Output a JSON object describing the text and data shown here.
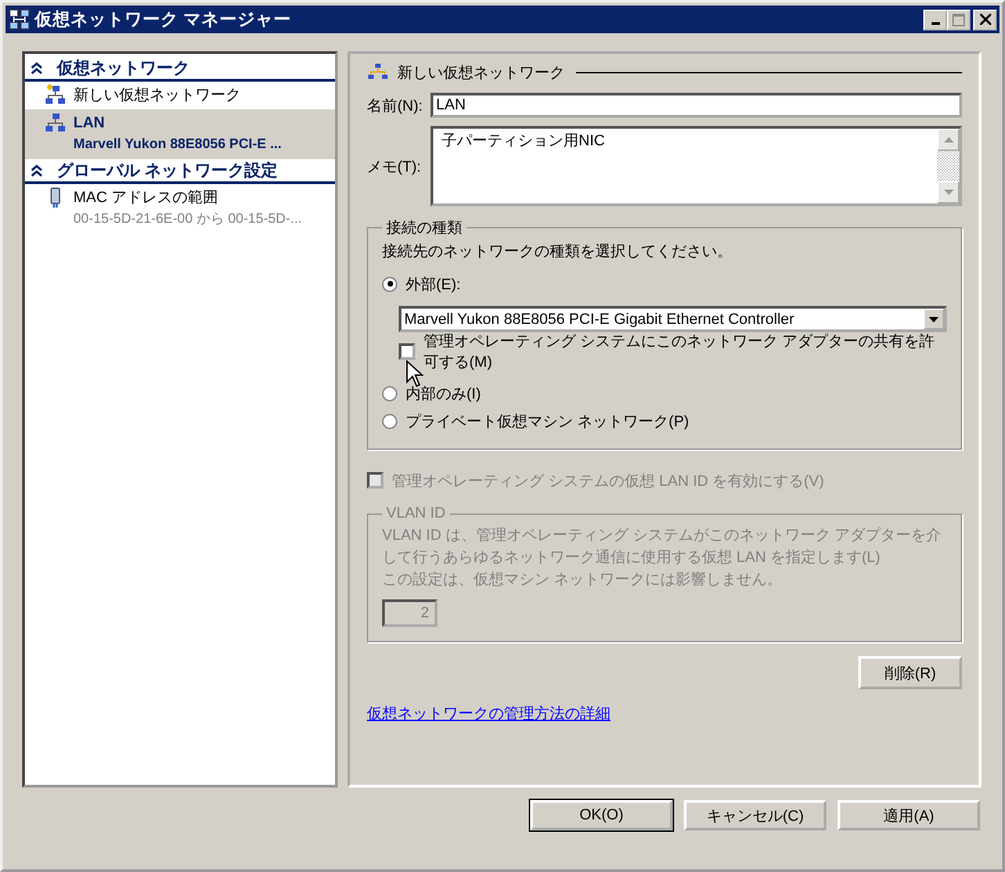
{
  "window": {
    "title": "仮想ネットワーク マネージャー"
  },
  "sidebar": {
    "sections": [
      {
        "title": "仮想ネットワーク",
        "expanded": true,
        "items": [
          {
            "kind": "new",
            "label": "新しい仮想ネットワーク",
            "selected": false
          },
          {
            "kind": "network",
            "label": "LAN",
            "detail": "Marvell Yukon 88E8056 PCI-E ...",
            "selected": true
          }
        ]
      },
      {
        "title": "グローバル ネットワーク設定",
        "expanded": true,
        "items": [
          {
            "kind": "mac",
            "label": "MAC アドレスの範囲",
            "detail": "00-15-5D-21-6E-00 から 00-15-5D-...",
            "selected": false
          }
        ]
      }
    ]
  },
  "panel": {
    "heading": "新しい仮想ネットワーク",
    "name_label": "名前(N):",
    "name_value": "LAN",
    "memo_label": "メモ(T):",
    "memo_value": "子パーティション用NIC",
    "connection": {
      "title": "接続の種類",
      "instruction": "接続先のネットワークの種類を選択してください。",
      "options": [
        {
          "label": "外部(E):",
          "selected": true,
          "adapter": "Marvell Yukon 88E8056 PCI-E Gigabit Ethernet Controller",
          "share": {
            "label": "管理オペレーティング システムにこのネットワーク アダプターの共有を許可する(M)",
            "checked": false
          }
        },
        {
          "label": "内部のみ(I)",
          "selected": false
        },
        {
          "label": "プライベート仮想マシン ネットワーク(P)",
          "selected": false
        }
      ]
    },
    "vlan_enable": {
      "label": "管理オペレーティング システムの仮想 LAN ID を有効にする(V)",
      "checked": false,
      "disabled": true
    },
    "vlan": {
      "title": "VLAN ID",
      "description": [
        "VLAN ID は、管理オペレーティング システムがこのネットワーク アダプターを介して行うあらゆるネットワーク通信に使用する仮想 LAN を指定します(L)",
        "この設定は、仮想マシン ネットワークには影響しません。"
      ],
      "value": "2",
      "disabled": true
    },
    "delete_button": "削除(R)",
    "help_link": "仮想ネットワークの管理方法の詳細"
  },
  "buttons": [
    {
      "label": "OK(O)",
      "default": true
    },
    {
      "label": "キャンセル(C)",
      "default": false
    },
    {
      "label": "適用(A)",
      "default": false
    }
  ]
}
